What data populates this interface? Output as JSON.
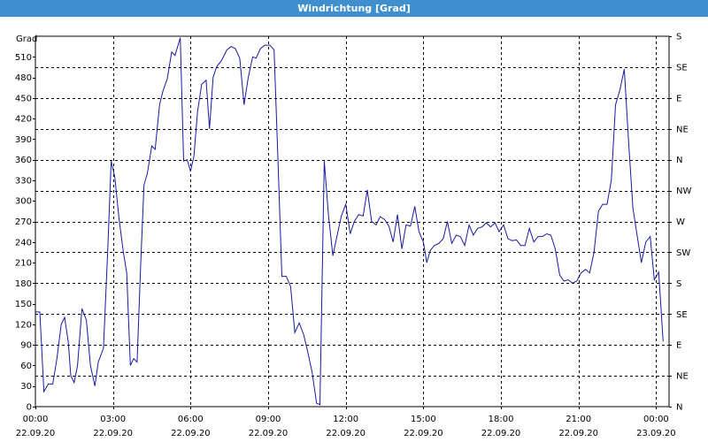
{
  "window": {
    "title": "Windrichtung [Grad]"
  },
  "chart_data": {
    "type": "line",
    "title": "Windrichtung [Grad]",
    "ylabel": "Grad",
    "xlabel": "",
    "ylim": [
      0,
      540
    ],
    "y_ticks": [
      0,
      30,
      60,
      90,
      120,
      150,
      180,
      210,
      240,
      270,
      300,
      330,
      360,
      390,
      420,
      450,
      480,
      510
    ],
    "right_axis": {
      "ticks": [
        0,
        45,
        90,
        135,
        180,
        225,
        270,
        315,
        360,
        405,
        450,
        495,
        540
      ],
      "labels": [
        "N",
        "NE",
        "E",
        "SE",
        "S",
        "SW",
        "W",
        "NW",
        "N",
        "NE",
        "E",
        "SE",
        "S"
      ]
    },
    "x_ticks": [
      {
        "time": "00:00",
        "date": "22.09.20",
        "hours": 0
      },
      {
        "time": "03:00",
        "date": "22.09.20",
        "hours": 3
      },
      {
        "time": "06:00",
        "date": "22.09.20",
        "hours": 6
      },
      {
        "time": "09:00",
        "date": "22.09.20",
        "hours": 9
      },
      {
        "time": "12:00",
        "date": "22.09.20",
        "hours": 12
      },
      {
        "time": "15:00",
        "date": "22.09.20",
        "hours": 15
      },
      {
        "time": "18:00",
        "date": "22.09.20",
        "hours": 18
      },
      {
        "time": "21:00",
        "date": "22.09.20",
        "hours": 21
      },
      {
        "time": "00:00",
        "date": "23.09.20",
        "hours": 24
      }
    ],
    "grid": true,
    "line_color": "#1a1aa0",
    "series": [
      {
        "values": [
          [
            0.0,
            138
          ],
          [
            0.17,
            138
          ],
          [
            0.33,
            22
          ],
          [
            0.5,
            33
          ],
          [
            0.67,
            33
          ],
          [
            0.83,
            70
          ],
          [
            1.0,
            120
          ],
          [
            1.13,
            130
          ],
          [
            1.27,
            95
          ],
          [
            1.37,
            45
          ],
          [
            1.5,
            35
          ],
          [
            1.63,
            60
          ],
          [
            1.8,
            143
          ],
          [
            1.97,
            126
          ],
          [
            2.13,
            60
          ],
          [
            2.3,
            30
          ],
          [
            2.43,
            65
          ],
          [
            2.63,
            85
          ],
          [
            2.8,
            230
          ],
          [
            2.93,
            358
          ],
          [
            3.07,
            335
          ],
          [
            3.23,
            275
          ],
          [
            3.4,
            225
          ],
          [
            3.53,
            195
          ],
          [
            3.67,
            60
          ],
          [
            3.8,
            70
          ],
          [
            3.93,
            65
          ],
          [
            4.07,
            205
          ],
          [
            4.2,
            323
          ],
          [
            4.33,
            340
          ],
          [
            4.5,
            380
          ],
          [
            4.63,
            375
          ],
          [
            4.8,
            440
          ],
          [
            4.93,
            460
          ],
          [
            5.1,
            478
          ],
          [
            5.27,
            517
          ],
          [
            5.4,
            512
          ],
          [
            5.6,
            538
          ],
          [
            5.73,
            358
          ],
          [
            5.87,
            360
          ],
          [
            6.0,
            343
          ],
          [
            6.13,
            365
          ],
          [
            6.27,
            430
          ],
          [
            6.43,
            470
          ],
          [
            6.6,
            476
          ],
          [
            6.73,
            405
          ],
          [
            6.87,
            480
          ],
          [
            7.0,
            495
          ],
          [
            7.2,
            505
          ],
          [
            7.4,
            520
          ],
          [
            7.57,
            525
          ],
          [
            7.73,
            522
          ],
          [
            7.9,
            508
          ],
          [
            8.07,
            440
          ],
          [
            8.23,
            480
          ],
          [
            8.4,
            510
          ],
          [
            8.53,
            508
          ],
          [
            8.7,
            522
          ],
          [
            8.87,
            527
          ],
          [
            9.07,
            527
          ],
          [
            9.23,
            520
          ],
          [
            9.37,
            370
          ],
          [
            9.53,
            190
          ],
          [
            9.7,
            190
          ],
          [
            9.87,
            175
          ],
          [
            10.03,
            108
          ],
          [
            10.2,
            122
          ],
          [
            10.37,
            105
          ],
          [
            10.53,
            80
          ],
          [
            10.7,
            50
          ],
          [
            10.87,
            5
          ],
          [
            11.0,
            3
          ],
          [
            11.17,
            358
          ],
          [
            11.33,
            280
          ],
          [
            11.5,
            220
          ],
          [
            11.67,
            250
          ],
          [
            11.83,
            278
          ],
          [
            12.0,
            295
          ],
          [
            12.17,
            252
          ],
          [
            12.33,
            270
          ],
          [
            12.5,
            280
          ],
          [
            12.67,
            278
          ],
          [
            12.83,
            316
          ],
          [
            13.0,
            270
          ],
          [
            13.17,
            265
          ],
          [
            13.33,
            277
          ],
          [
            13.5,
            273
          ],
          [
            13.67,
            263
          ],
          [
            13.83,
            240
          ],
          [
            14.0,
            280
          ],
          [
            14.17,
            230
          ],
          [
            14.33,
            265
          ],
          [
            14.5,
            263
          ],
          [
            14.67,
            292
          ],
          [
            14.83,
            255
          ],
          [
            15.0,
            240
          ],
          [
            15.13,
            210
          ],
          [
            15.27,
            228
          ],
          [
            15.43,
            235
          ],
          [
            15.6,
            238
          ],
          [
            15.77,
            245
          ],
          [
            15.93,
            270
          ],
          [
            16.1,
            238
          ],
          [
            16.27,
            250
          ],
          [
            16.43,
            248
          ],
          [
            16.6,
            235
          ],
          [
            16.77,
            265
          ],
          [
            16.93,
            250
          ],
          [
            17.1,
            260
          ],
          [
            17.27,
            262
          ],
          [
            17.43,
            268
          ],
          [
            17.6,
            262
          ],
          [
            17.77,
            268
          ],
          [
            17.93,
            255
          ],
          [
            18.1,
            265
          ],
          [
            18.27,
            245
          ],
          [
            18.43,
            242
          ],
          [
            18.6,
            243
          ],
          [
            18.77,
            235
          ],
          [
            18.93,
            235
          ],
          [
            19.1,
            260
          ],
          [
            19.27,
            240
          ],
          [
            19.43,
            248
          ],
          [
            19.6,
            248
          ],
          [
            19.77,
            252
          ],
          [
            19.93,
            250
          ],
          [
            20.1,
            230
          ],
          [
            20.27,
            192
          ],
          [
            20.43,
            183
          ],
          [
            20.6,
            185
          ],
          [
            20.77,
            180
          ],
          [
            20.93,
            183
          ],
          [
            21.1,
            195
          ],
          [
            21.27,
            200
          ],
          [
            21.43,
            195
          ],
          [
            21.6,
            225
          ],
          [
            21.77,
            285
          ],
          [
            21.93,
            295
          ],
          [
            22.1,
            295
          ],
          [
            22.27,
            330
          ],
          [
            22.43,
            440
          ],
          [
            22.6,
            462
          ],
          [
            22.77,
            492
          ],
          [
            22.93,
            390
          ],
          [
            23.1,
            290
          ],
          [
            23.27,
            248
          ],
          [
            23.43,
            210
          ],
          [
            23.6,
            240
          ],
          [
            23.77,
            248
          ],
          [
            23.93,
            185
          ],
          [
            24.1,
            196
          ],
          [
            24.27,
            95
          ]
        ]
      }
    ]
  }
}
